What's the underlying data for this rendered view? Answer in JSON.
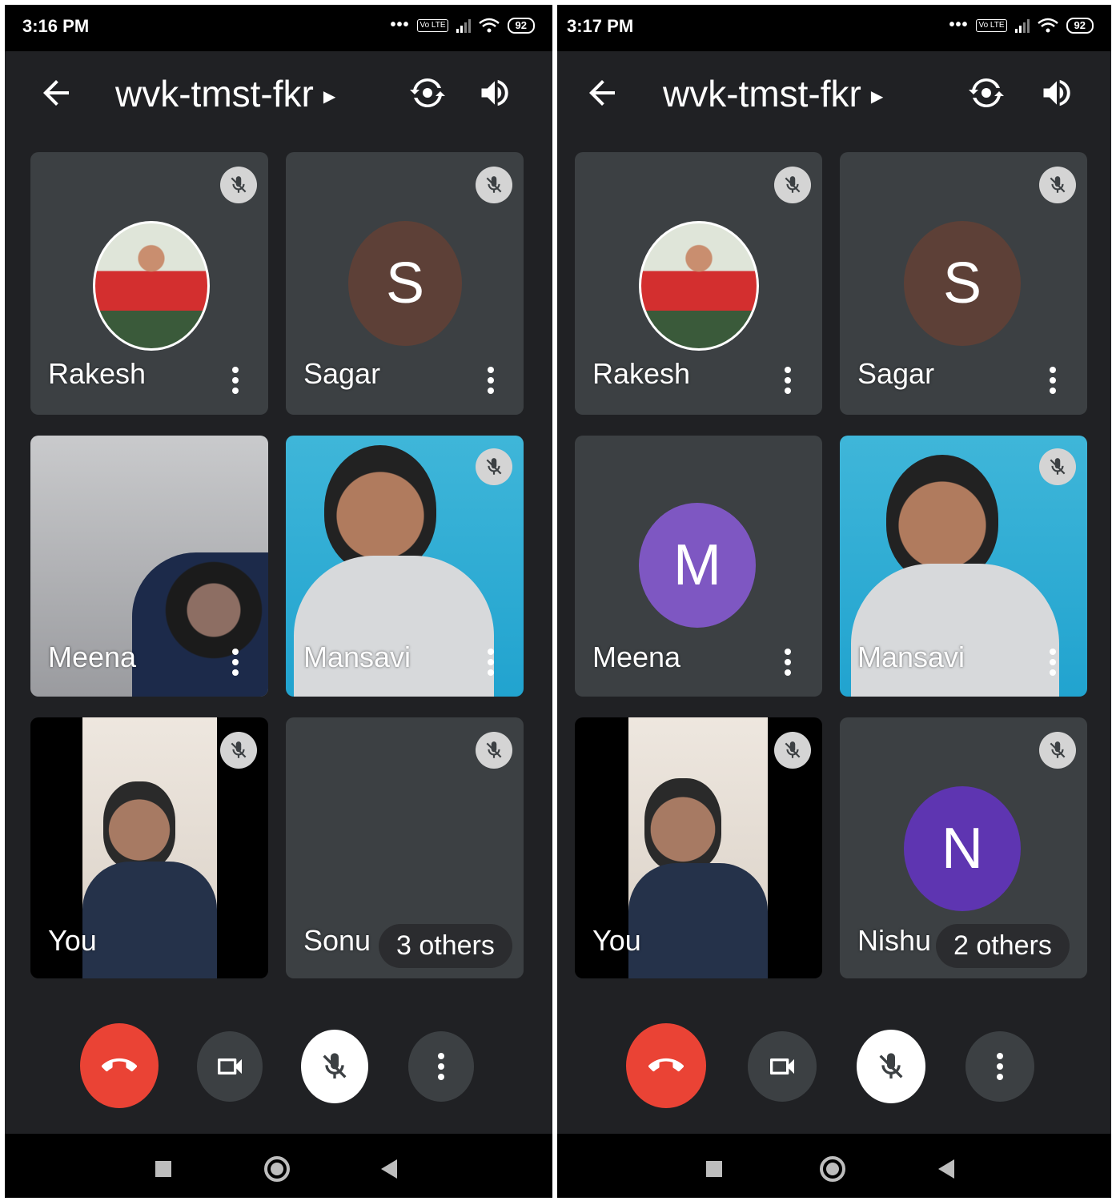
{
  "colors": {
    "bg": "#202124",
    "tile": "#3c4043",
    "end_call": "#ea4335",
    "avatar_s": "#5d4037",
    "avatar_m": "#7e57c2",
    "avatar_n": "#5e35b1"
  },
  "phone1": {
    "status": {
      "time": "3:16 PM",
      "battery": "92",
      "volte": "Vo LTE"
    },
    "meeting_code": "wvk-tmst-fkr",
    "tiles": {
      "rakesh": "Rakesh",
      "sagar": {
        "name": "Sagar",
        "initial": "S"
      },
      "meena": "Meena",
      "mansavi": "Mansavi",
      "you": "You",
      "sonu": {
        "name": "Sonu",
        "others": "3 others"
      }
    }
  },
  "phone2": {
    "status": {
      "time": "3:17 PM",
      "battery": "92",
      "volte": "Vo LTE"
    },
    "meeting_code": "wvk-tmst-fkr",
    "tiles": {
      "rakesh": "Rakesh",
      "sagar": {
        "name": "Sagar",
        "initial": "S"
      },
      "meena": {
        "name": "Meena",
        "initial": "M"
      },
      "mansavi": "Mansavi",
      "you": "You",
      "nishu": {
        "name": "Nishu",
        "initial": "N",
        "others": "2 others"
      }
    }
  },
  "icons": [
    "back-arrow-icon",
    "switch-camera-icon",
    "speaker-icon",
    "mic-off-icon",
    "more-vert-icon",
    "end-call-icon",
    "camera-icon"
  ]
}
